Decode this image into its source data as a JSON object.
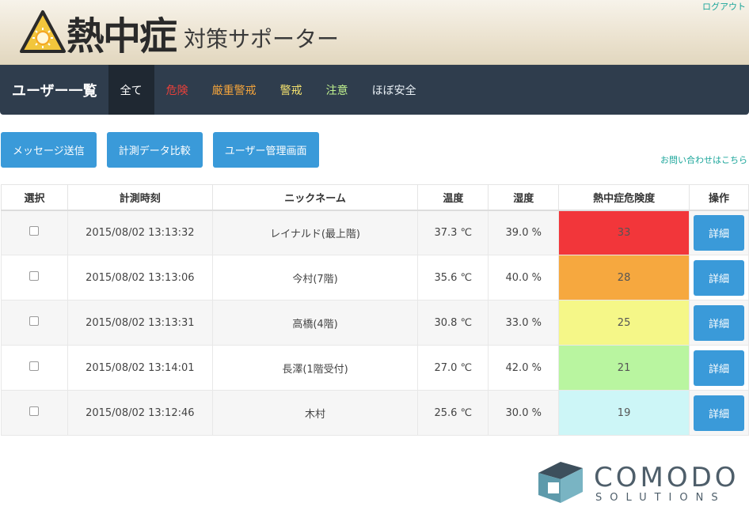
{
  "header": {
    "logo_main": "熱中症",
    "logo_sub": "対策サポーター",
    "logout_label": "ログアウト"
  },
  "navbar": {
    "brand": "ユーザー一覧",
    "tabs": [
      {
        "label": "全て",
        "color": "#ffffff"
      },
      {
        "label": "危険",
        "color": "#e8403a"
      },
      {
        "label": "厳重警戒",
        "color": "#f0a23c"
      },
      {
        "label": "警戒",
        "color": "#f2e06e"
      },
      {
        "label": "注意",
        "color": "#bff08e"
      },
      {
        "label": "ほぼ安全",
        "color": "#e9f0f5"
      }
    ]
  },
  "actions": {
    "send_message": "メッセージ送信",
    "compare_data": "計測データ比較",
    "user_admin": "ユーザー管理画面",
    "contact": "お問い合わせはこちら"
  },
  "table": {
    "headers": [
      "選択",
      "計測時刻",
      "ニックネーム",
      "温度",
      "湿度",
      "熱中症危険度",
      "操作"
    ],
    "rows": [
      {
        "time": "2015/08/02 13:13:32",
        "nickname": "レイナルド(最上階)",
        "temp": "37.3 ℃",
        "humidity": "39.0 %",
        "risk": "33",
        "risk_color": "#f2363a",
        "action": "詳細"
      },
      {
        "time": "2015/08/02 13:13:06",
        "nickname": "今村(7階)",
        "temp": "35.6 ℃",
        "humidity": "40.0 %",
        "risk": "28",
        "risk_color": "#f6a83f",
        "action": "詳細"
      },
      {
        "time": "2015/08/02 13:13:31",
        "nickname": "高橋(4階)",
        "temp": "30.8 ℃",
        "humidity": "33.0 %",
        "risk": "25",
        "risk_color": "#f5f788",
        "action": "詳細"
      },
      {
        "time": "2015/08/02 13:14:01",
        "nickname": "長澤(1階受付)",
        "temp": "27.0 ℃",
        "humidity": "42.0 %",
        "risk": "21",
        "risk_color": "#b9f5a0",
        "action": "詳細"
      },
      {
        "time": "2015/08/02 13:12:46",
        "nickname": "木村",
        "temp": "25.6 ℃",
        "humidity": "30.0 %",
        "risk": "19",
        "risk_color": "#cdf6f7",
        "action": "詳細"
      }
    ]
  },
  "footer": {
    "brand_top": "COMODO",
    "brand_bottom": "SOLUTIONS"
  },
  "colors": {
    "accent_button": "#3a9ad9",
    "navbar": "#2f3d4d",
    "link_teal": "#1aa59a"
  }
}
